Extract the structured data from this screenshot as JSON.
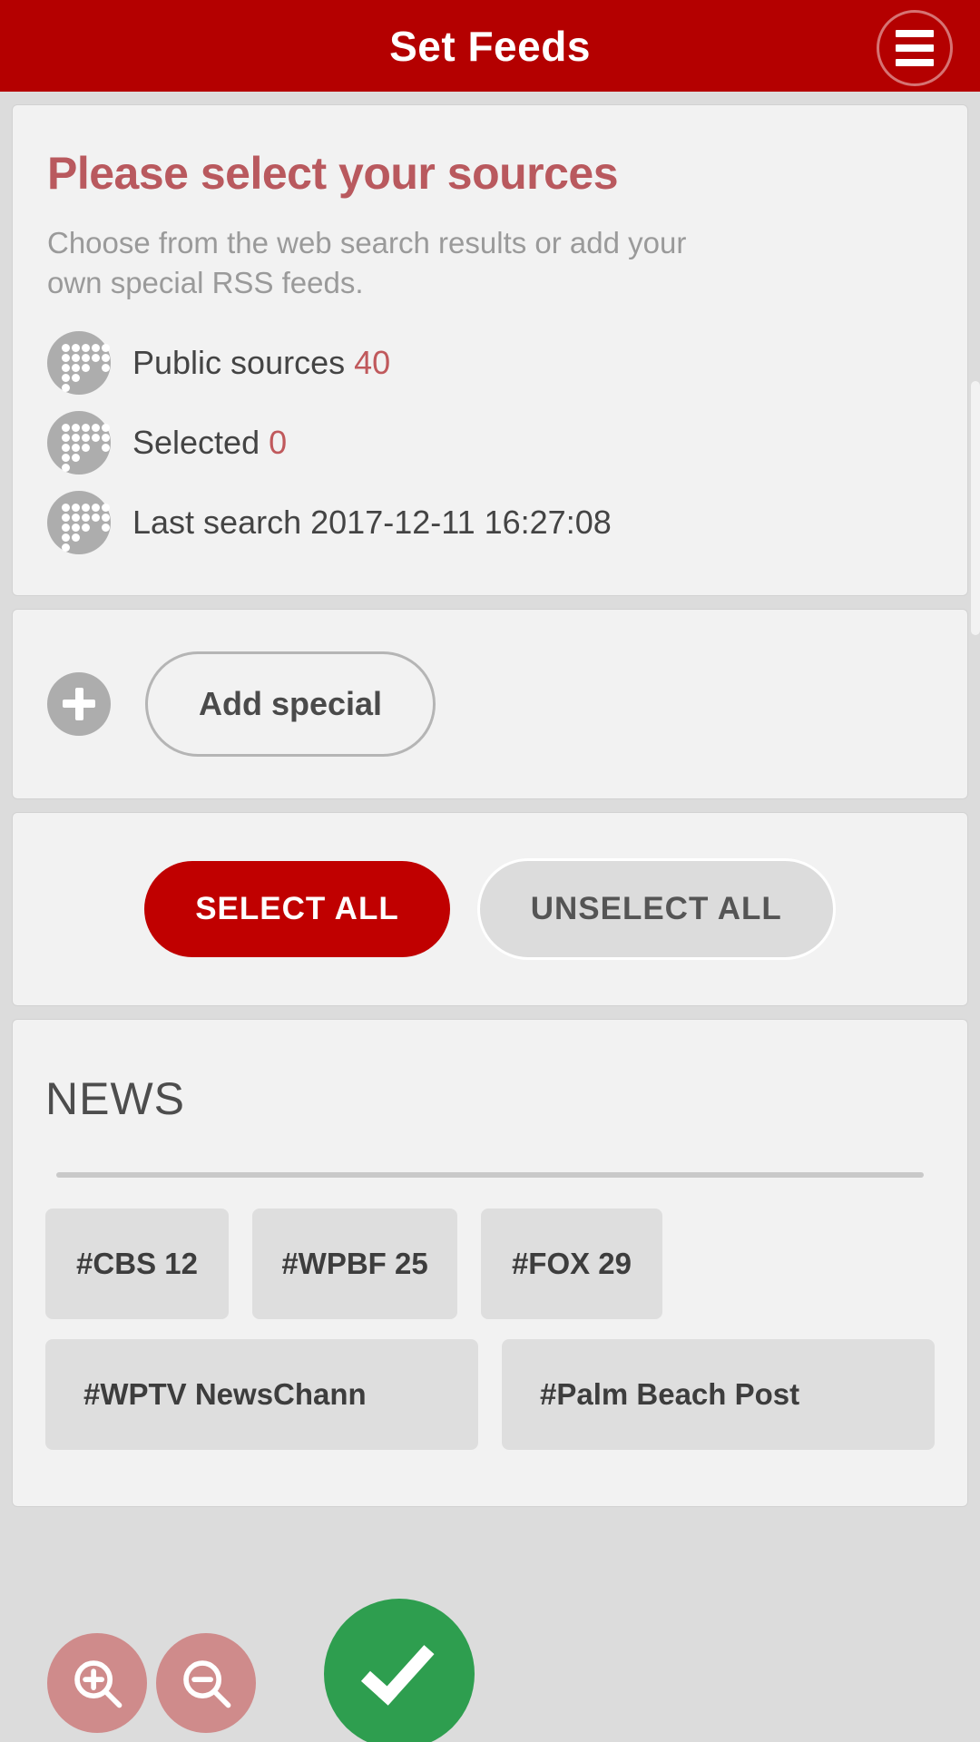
{
  "header": {
    "title": "Set Feeds",
    "menu_icon": "hamburger-menu-icon"
  },
  "sources_card": {
    "headline": "Please select your sources",
    "subtext": "Choose from the web search results or add your own special RSS feeds.",
    "rows": [
      {
        "icon": "dot-grid-icon",
        "label": "Public sources",
        "value": "40"
      },
      {
        "icon": "dot-grid-icon",
        "label": "Selected",
        "value": "0"
      },
      {
        "icon": "dot-grid-icon",
        "label": "Last search",
        "value": "2017-12-11 16:27:08"
      }
    ]
  },
  "add_special": {
    "plus_icon": "plus-icon",
    "label": "Add special"
  },
  "selection_actions": {
    "select_all": "SELECT ALL",
    "unselect_all": "UNSELECT ALL"
  },
  "news_section": {
    "title": "NEWS",
    "chips_row1": [
      "#CBS 12",
      "#WPBF 25",
      "#FOX 29"
    ],
    "chips_row2": [
      "#WPTV NewsChann",
      "#Palm Beach Post"
    ]
  },
  "floating_actions": {
    "zoom_in_icon": "zoom-in-magnifier-icon",
    "zoom_out_icon": "zoom-out-magnifier-icon",
    "confirm_icon": "checkmark-icon"
  },
  "colors": {
    "header_red": "#b40000",
    "accent_red": "#c00000",
    "headline_red": "#b9595e",
    "value_red": "#c0595c",
    "confirm_green": "#2e9e4f",
    "fab_pink": "#cf8b8b",
    "card_bg": "#f2f2f2",
    "page_bg": "#dcdcdc",
    "chip_bg": "#dedede"
  }
}
